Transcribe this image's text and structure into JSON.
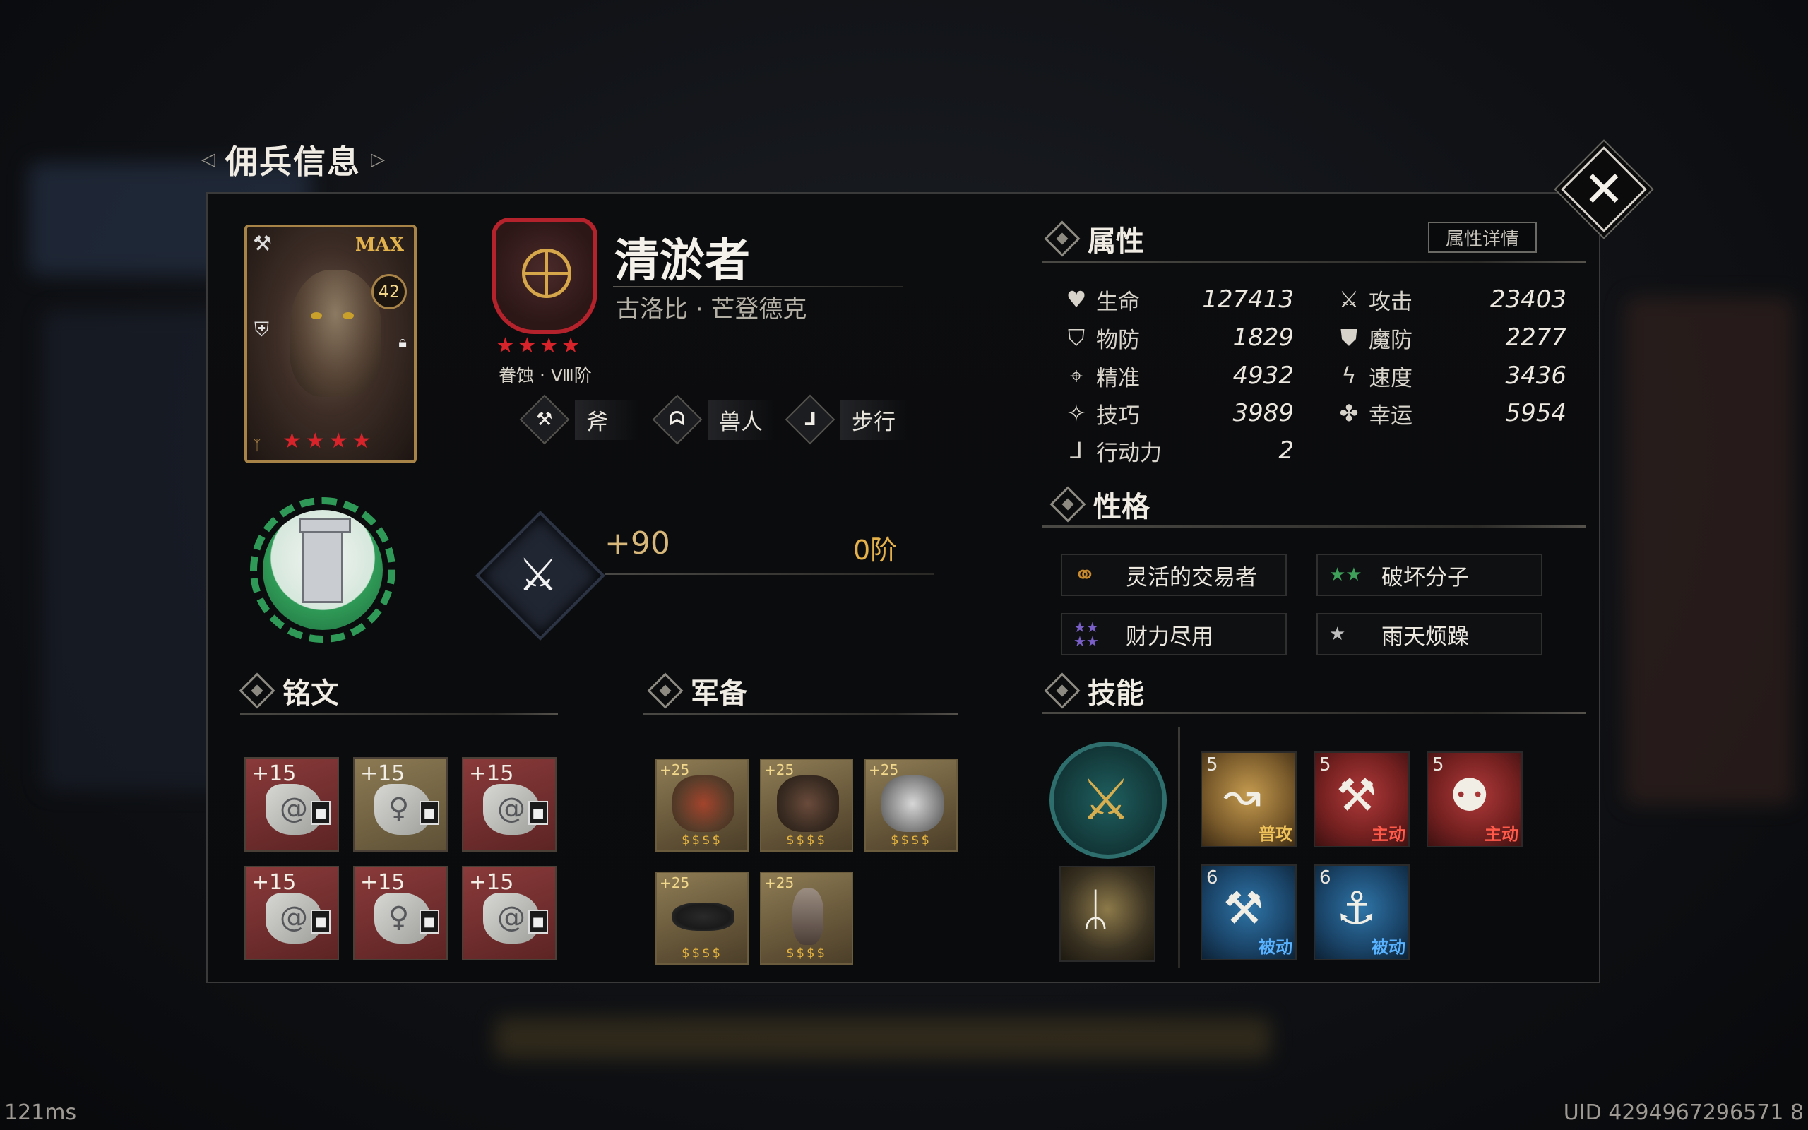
{
  "window": {
    "title": "佣兵信息"
  },
  "hero": {
    "card_badge": "MAX",
    "level": "42",
    "name": "清淤者",
    "subtitle": "古洛比 · 芒登德克",
    "rank": "眷蚀 · Ⅷ阶",
    "tags": [
      {
        "icon": "axe-icon",
        "label": "斧"
      },
      {
        "icon": "orc-icon",
        "label": "兽人"
      },
      {
        "icon": "boot-icon",
        "label": "步行"
      }
    ]
  },
  "weapon": {
    "icon": "battle-axe-icon",
    "bonus": "+90",
    "stage": "0阶"
  },
  "sections": {
    "attributes": "属性",
    "personality": "性格",
    "inscriptions": "铭文",
    "equipment": "军备",
    "skills": "技能"
  },
  "attributes": {
    "detail_button": "属性详情",
    "left": [
      {
        "icon": "heart-icon",
        "name": "生命",
        "value": "127413"
      },
      {
        "icon": "shield-icon",
        "name": "物防",
        "value": "1829"
      },
      {
        "icon": "crosshair-icon",
        "name": "精准",
        "value": "4932"
      },
      {
        "icon": "claw-icon",
        "name": "技巧",
        "value": "3989"
      },
      {
        "icon": "walk-icon",
        "name": "行动力",
        "value": "2"
      }
    ],
    "right": [
      {
        "icon": "crossed-swords-icon",
        "name": "攻击",
        "value": "23403"
      },
      {
        "icon": "magic-shield-icon",
        "name": "魔防",
        "value": "2277"
      },
      {
        "icon": "wind-icon",
        "name": "速度",
        "value": "3436"
      },
      {
        "icon": "clover-icon",
        "name": "幸运",
        "value": "5954"
      }
    ]
  },
  "traits": [
    {
      "icon": "triple-ring-icon",
      "label": "灵活的交易者",
      "color": "#c98a2e"
    },
    {
      "icon": "two-star-icon",
      "label": "破坏分子",
      "color": "#3fa05a"
    },
    {
      "icon": "four-star-icon",
      "label": "财力尽用",
      "color": "#7a5fc8"
    },
    {
      "icon": "one-star-icon",
      "label": "雨天烦躁",
      "color": "#bdbdbd"
    }
  ],
  "inscriptions": [
    {
      "plus": "+15",
      "tone": "red"
    },
    {
      "plus": "+15",
      "tone": "gold"
    },
    {
      "plus": "+15",
      "tone": "red"
    },
    {
      "plus": "+15",
      "tone": "red"
    },
    {
      "plus": "+15",
      "tone": "red"
    },
    {
      "plus": "+15",
      "tone": "red"
    }
  ],
  "equipment": [
    {
      "plus": "+25",
      "name": "chest-armor",
      "stars": 4
    },
    {
      "plus": "+25",
      "name": "spiked-helmet",
      "stars": 4
    },
    {
      "plus": "+25",
      "name": "gauntlet",
      "stars": 4
    },
    {
      "plus": "+25",
      "name": "ring-band",
      "stars": 4
    },
    {
      "plus": "+25",
      "name": "bracer",
      "stars": 4
    }
  ],
  "skills": [
    {
      "level": "5",
      "type": "普攻",
      "tone": "gold",
      "type_color": "#f0c25a"
    },
    {
      "level": "5",
      "type": "主动",
      "tone": "red",
      "type_color": "#ff5a4a"
    },
    {
      "level": "5",
      "type": "主动",
      "tone": "red",
      "type_color": "#ff5a4a"
    },
    {
      "level": "6",
      "type": "被动",
      "tone": "blue",
      "type_color": "#58b2ff"
    },
    {
      "level": "6",
      "type": "被动",
      "tone": "blue",
      "type_color": "#58b2ff"
    }
  ],
  "footer": {
    "latency": "121ms",
    "uid": "UID 4294967296571 8"
  }
}
